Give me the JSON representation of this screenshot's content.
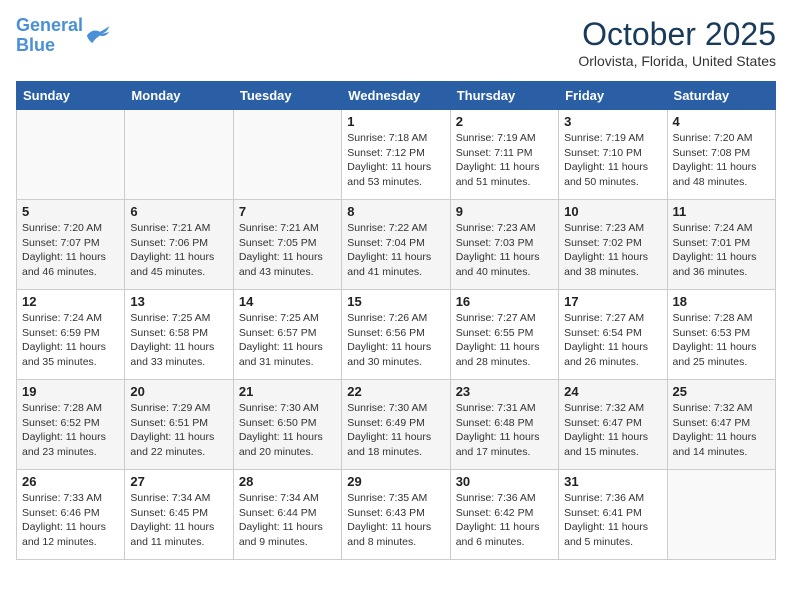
{
  "logo": {
    "line1": "General",
    "line2": "Blue"
  },
  "title": "October 2025",
  "location": "Orlovista, Florida, United States",
  "weekdays": [
    "Sunday",
    "Monday",
    "Tuesday",
    "Wednesday",
    "Thursday",
    "Friday",
    "Saturday"
  ],
  "weeks": [
    [
      {
        "day": "",
        "info": ""
      },
      {
        "day": "",
        "info": ""
      },
      {
        "day": "",
        "info": ""
      },
      {
        "day": "1",
        "info": "Sunrise: 7:18 AM\nSunset: 7:12 PM\nDaylight: 11 hours\nand 53 minutes."
      },
      {
        "day": "2",
        "info": "Sunrise: 7:19 AM\nSunset: 7:11 PM\nDaylight: 11 hours\nand 51 minutes."
      },
      {
        "day": "3",
        "info": "Sunrise: 7:19 AM\nSunset: 7:10 PM\nDaylight: 11 hours\nand 50 minutes."
      },
      {
        "day": "4",
        "info": "Sunrise: 7:20 AM\nSunset: 7:08 PM\nDaylight: 11 hours\nand 48 minutes."
      }
    ],
    [
      {
        "day": "5",
        "info": "Sunrise: 7:20 AM\nSunset: 7:07 PM\nDaylight: 11 hours\nand 46 minutes."
      },
      {
        "day": "6",
        "info": "Sunrise: 7:21 AM\nSunset: 7:06 PM\nDaylight: 11 hours\nand 45 minutes."
      },
      {
        "day": "7",
        "info": "Sunrise: 7:21 AM\nSunset: 7:05 PM\nDaylight: 11 hours\nand 43 minutes."
      },
      {
        "day": "8",
        "info": "Sunrise: 7:22 AM\nSunset: 7:04 PM\nDaylight: 11 hours\nand 41 minutes."
      },
      {
        "day": "9",
        "info": "Sunrise: 7:23 AM\nSunset: 7:03 PM\nDaylight: 11 hours\nand 40 minutes."
      },
      {
        "day": "10",
        "info": "Sunrise: 7:23 AM\nSunset: 7:02 PM\nDaylight: 11 hours\nand 38 minutes."
      },
      {
        "day": "11",
        "info": "Sunrise: 7:24 AM\nSunset: 7:01 PM\nDaylight: 11 hours\nand 36 minutes."
      }
    ],
    [
      {
        "day": "12",
        "info": "Sunrise: 7:24 AM\nSunset: 6:59 PM\nDaylight: 11 hours\nand 35 minutes."
      },
      {
        "day": "13",
        "info": "Sunrise: 7:25 AM\nSunset: 6:58 PM\nDaylight: 11 hours\nand 33 minutes."
      },
      {
        "day": "14",
        "info": "Sunrise: 7:25 AM\nSunset: 6:57 PM\nDaylight: 11 hours\nand 31 minutes."
      },
      {
        "day": "15",
        "info": "Sunrise: 7:26 AM\nSunset: 6:56 PM\nDaylight: 11 hours\nand 30 minutes."
      },
      {
        "day": "16",
        "info": "Sunrise: 7:27 AM\nSunset: 6:55 PM\nDaylight: 11 hours\nand 28 minutes."
      },
      {
        "day": "17",
        "info": "Sunrise: 7:27 AM\nSunset: 6:54 PM\nDaylight: 11 hours\nand 26 minutes."
      },
      {
        "day": "18",
        "info": "Sunrise: 7:28 AM\nSunset: 6:53 PM\nDaylight: 11 hours\nand 25 minutes."
      }
    ],
    [
      {
        "day": "19",
        "info": "Sunrise: 7:28 AM\nSunset: 6:52 PM\nDaylight: 11 hours\nand 23 minutes."
      },
      {
        "day": "20",
        "info": "Sunrise: 7:29 AM\nSunset: 6:51 PM\nDaylight: 11 hours\nand 22 minutes."
      },
      {
        "day": "21",
        "info": "Sunrise: 7:30 AM\nSunset: 6:50 PM\nDaylight: 11 hours\nand 20 minutes."
      },
      {
        "day": "22",
        "info": "Sunrise: 7:30 AM\nSunset: 6:49 PM\nDaylight: 11 hours\nand 18 minutes."
      },
      {
        "day": "23",
        "info": "Sunrise: 7:31 AM\nSunset: 6:48 PM\nDaylight: 11 hours\nand 17 minutes."
      },
      {
        "day": "24",
        "info": "Sunrise: 7:32 AM\nSunset: 6:47 PM\nDaylight: 11 hours\nand 15 minutes."
      },
      {
        "day": "25",
        "info": "Sunrise: 7:32 AM\nSunset: 6:47 PM\nDaylight: 11 hours\nand 14 minutes."
      }
    ],
    [
      {
        "day": "26",
        "info": "Sunrise: 7:33 AM\nSunset: 6:46 PM\nDaylight: 11 hours\nand 12 minutes."
      },
      {
        "day": "27",
        "info": "Sunrise: 7:34 AM\nSunset: 6:45 PM\nDaylight: 11 hours\nand 11 minutes."
      },
      {
        "day": "28",
        "info": "Sunrise: 7:34 AM\nSunset: 6:44 PM\nDaylight: 11 hours\nand 9 minutes."
      },
      {
        "day": "29",
        "info": "Sunrise: 7:35 AM\nSunset: 6:43 PM\nDaylight: 11 hours\nand 8 minutes."
      },
      {
        "day": "30",
        "info": "Sunrise: 7:36 AM\nSunset: 6:42 PM\nDaylight: 11 hours\nand 6 minutes."
      },
      {
        "day": "31",
        "info": "Sunrise: 7:36 AM\nSunset: 6:41 PM\nDaylight: 11 hours\nand 5 minutes."
      },
      {
        "day": "",
        "info": ""
      }
    ]
  ]
}
